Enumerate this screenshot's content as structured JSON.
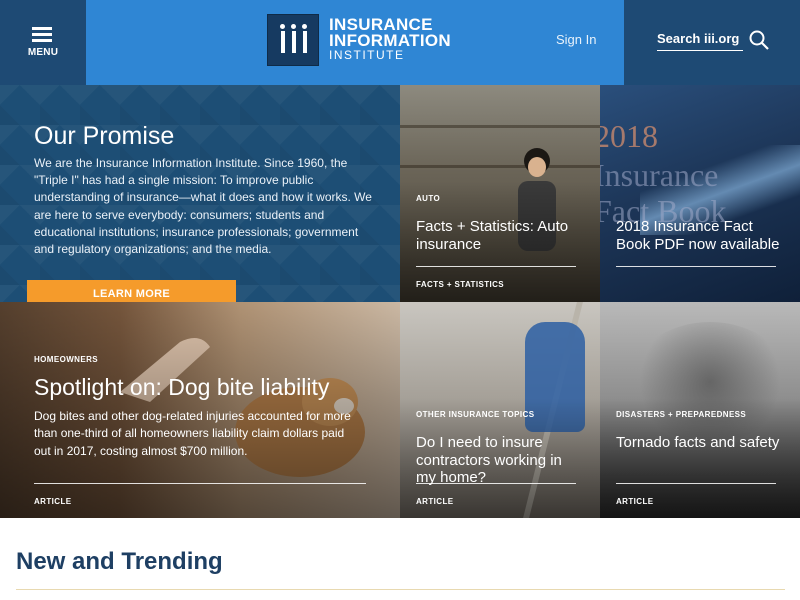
{
  "header": {
    "menu_label": "MENU",
    "logo_line1": "INSURANCE",
    "logo_line2": "INFORMATION",
    "logo_line3": "INSTITUTE",
    "sign_in": "Sign In",
    "search_placeholder": "Search iii.org",
    "colors": {
      "dark_blue": "#1e4a74",
      "brand_blue": "#2f86d4"
    }
  },
  "promise": {
    "heading": "Our Promise",
    "body": "We are the Insurance Information Institute. Since 1960, the \"Triple I\" has had a single mission: To improve public understanding of insurance—what it does and how it works. We are here to serve everybody: consumers; students and educational institutions; insurance professionals; government and regulatory organizations; and the media.",
    "button": "LEARN MORE",
    "button_color": "#f59b2b"
  },
  "tiles": {
    "auto": {
      "category": "AUTO",
      "title": "Facts + Statistics: Auto insurance",
      "footer": "FACTS + STATISTICS"
    },
    "factbook": {
      "bg_year": "2018",
      "bg_line2": "Insurance",
      "bg_line3": "Fact Book",
      "title": "2018 Insurance Fact Book PDF now available"
    },
    "homeowners": {
      "category": "HOMEOWNERS",
      "title": "Spotlight on: Dog bite liability",
      "body": "Dog bites and other dog-related injuries accounted for more than one-third of all homeowners liability claim dollars paid out in 2017, costing almost $700 million.",
      "footer": "ARTICLE"
    },
    "contractors": {
      "category": "OTHER INSURANCE TOPICS",
      "title": "Do I need to insure contractors working in my home?",
      "footer": "ARTICLE"
    },
    "tornado": {
      "category": "DISASTERS + PREPAREDNESS",
      "title": "Tornado facts and safety",
      "footer": "ARTICLE"
    }
  },
  "trending": {
    "heading": "New and Trending"
  }
}
